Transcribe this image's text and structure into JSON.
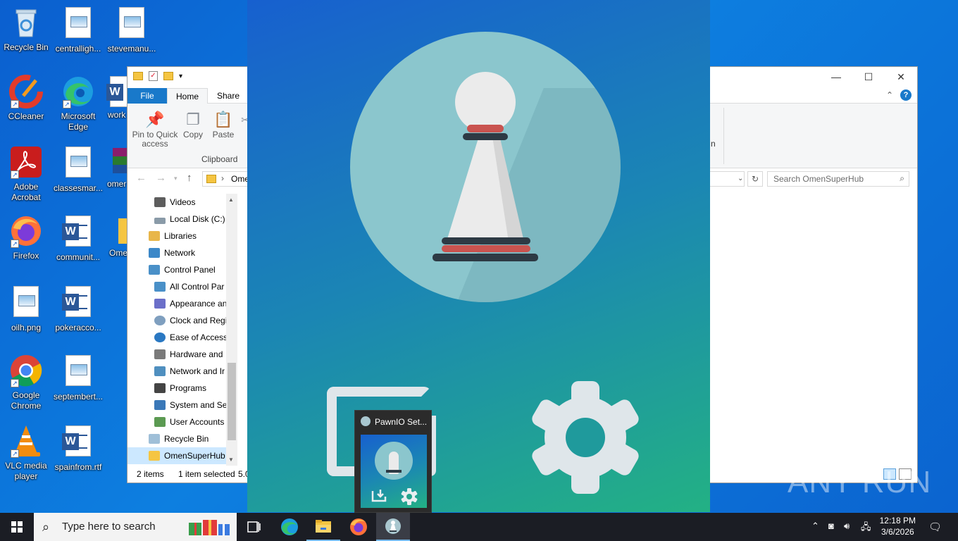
{
  "desktop": {
    "icons": [
      {
        "label": "Recycle Bin",
        "icon": "recycle-bin-icon"
      },
      {
        "label": "centralligh...",
        "icon": "image-file-icon"
      },
      {
        "label": "stevemanu...",
        "icon": "image-file-icon"
      },
      {
        "label": "CCleaner",
        "icon": "ccleaner-icon"
      },
      {
        "label": "Microsoft Edge",
        "icon": "edge-icon"
      },
      {
        "label": "work",
        "icon": "word-file-icon"
      },
      {
        "label": "Adobe Acrobat",
        "icon": "acrobat-icon"
      },
      {
        "label": "classesmar...",
        "icon": "image-file-icon"
      },
      {
        "label": "omer",
        "icon": "winrar-icon"
      },
      {
        "label": "Firefox",
        "icon": "firefox-icon"
      },
      {
        "label": "communit...",
        "icon": "word-file-icon"
      },
      {
        "label": "Ome",
        "icon": "folder-icon"
      },
      {
        "label": "oilh.png",
        "icon": "image-file-icon"
      },
      {
        "label": "pokeracco...",
        "icon": "word-file-icon"
      },
      {
        "label": "Google Chrome",
        "icon": "chrome-icon"
      },
      {
        "label": "septembert...",
        "icon": "image-file-icon"
      },
      {
        "label": "VLC media player",
        "icon": "vlc-icon"
      },
      {
        "label": "spainfrom.rtf",
        "icon": "word-file-icon"
      }
    ]
  },
  "explorer": {
    "tabs": {
      "file": "File",
      "home": "Home",
      "share": "Share"
    },
    "ribbon": {
      "pin_label": "Pin to Quick access",
      "copy_label": "Copy",
      "paste_label": "Paste",
      "group_clipboard": "Clipboard",
      "fragment": "n"
    },
    "address": {
      "path": "Omen"
    },
    "search": {
      "placeholder": "Search OmenSuperHub"
    },
    "nav_items": [
      {
        "label": "Videos",
        "icon": "videos-icon"
      },
      {
        "label": "Local Disk (C:)",
        "icon": "drive-icon"
      },
      {
        "label": "Libraries",
        "icon": "libraries-icon"
      },
      {
        "label": "Network",
        "icon": "network-icon"
      },
      {
        "label": "Control Panel",
        "icon": "control-panel-icon"
      },
      {
        "label": "All Control Par",
        "icon": "control-panel-icon"
      },
      {
        "label": "Appearance an",
        "icon": "appearance-icon"
      },
      {
        "label": "Clock and Regi",
        "icon": "clock-icon"
      },
      {
        "label": "Ease of Access",
        "icon": "ease-of-access-icon"
      },
      {
        "label": "Hardware and",
        "icon": "hardware-icon"
      },
      {
        "label": "Network and Ir",
        "icon": "network-internet-icon"
      },
      {
        "label": "Programs",
        "icon": "programs-icon"
      },
      {
        "label": "System and Se",
        "icon": "system-security-icon"
      },
      {
        "label": "User Accounts",
        "icon": "user-accounts-icon"
      },
      {
        "label": "Recycle Bin",
        "icon": "recycle-bin-icon"
      },
      {
        "label": "OmenSuperHub",
        "icon": "folder-icon"
      }
    ],
    "status": {
      "items": "2 items",
      "selected": "1 item selected",
      "size": "5.0"
    }
  },
  "thumbnail": {
    "title": "PawnIO Set..."
  },
  "watermark": {
    "text": "ANY RUN"
  },
  "taskbar": {
    "search_placeholder": "Type here to search",
    "clock_time": "12:18 PM",
    "clock_date": "3/6/2026"
  }
}
